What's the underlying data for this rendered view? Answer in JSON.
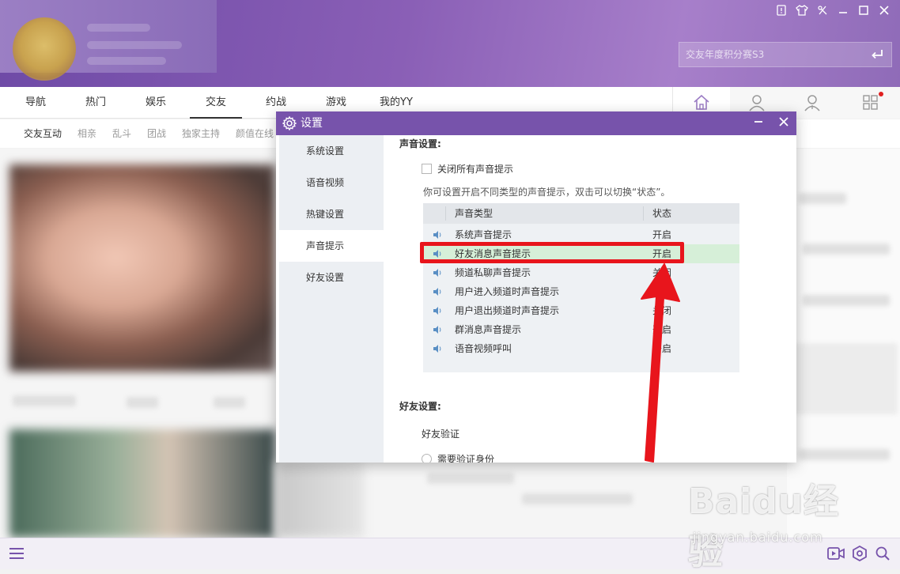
{
  "header": {
    "search_placeholder": "交友年度积分赛S3",
    "window_controls": [
      "feedback-icon",
      "skin-icon",
      "menu-icon",
      "minimize-icon",
      "maximize-icon",
      "close-icon"
    ]
  },
  "nav": {
    "tabs": [
      "导航",
      "热门",
      "娱乐",
      "交友",
      "约战",
      "游戏",
      "我的YY"
    ],
    "active_tab": "交友"
  },
  "subnav": {
    "items": [
      "交友互动",
      "相亲",
      "乱斗",
      "团战",
      "独家主持",
      "颜值在线"
    ],
    "active": "交友互动"
  },
  "dialog": {
    "title": "设置",
    "sidebar": [
      "系统设置",
      "语音视频",
      "热键设置",
      "声音提示",
      "好友设置"
    ],
    "active_sidebar": "声音提示",
    "sound_section": {
      "title": "声音设置:",
      "disable_all_label": "关闭所有声音提示",
      "hint": "你可设置开启不同类型的声音提示，双击可以切换“状态”。",
      "columns": [
        "声音类型",
        "状态"
      ],
      "rows": [
        {
          "name": "系统声音提示",
          "status": "开启"
        },
        {
          "name": "好友消息声音提示",
          "status": "开启"
        },
        {
          "name": "频道私聊声音提示",
          "status": "关闭"
        },
        {
          "name": "用户进入频道时声音提示",
          "status": "关闭"
        },
        {
          "name": "用户退出频道时声音提示",
          "status": "关闭"
        },
        {
          "name": "群消息声音提示",
          "status": "开启"
        },
        {
          "name": "语音视频呼叫",
          "status": "开启"
        }
      ],
      "highlighted_row": 1
    },
    "friend_section": {
      "title": "好友设置:",
      "verify_label": "好友验证",
      "verify_option": "需要验证身份"
    }
  },
  "watermark": {
    "brand": "Baidu经验",
    "url": "jingyan.baidu.com"
  },
  "colors": {
    "header_purple": "#7753ab",
    "highlight_row": "#d6efd8",
    "annotation_red": "#e8151c"
  }
}
